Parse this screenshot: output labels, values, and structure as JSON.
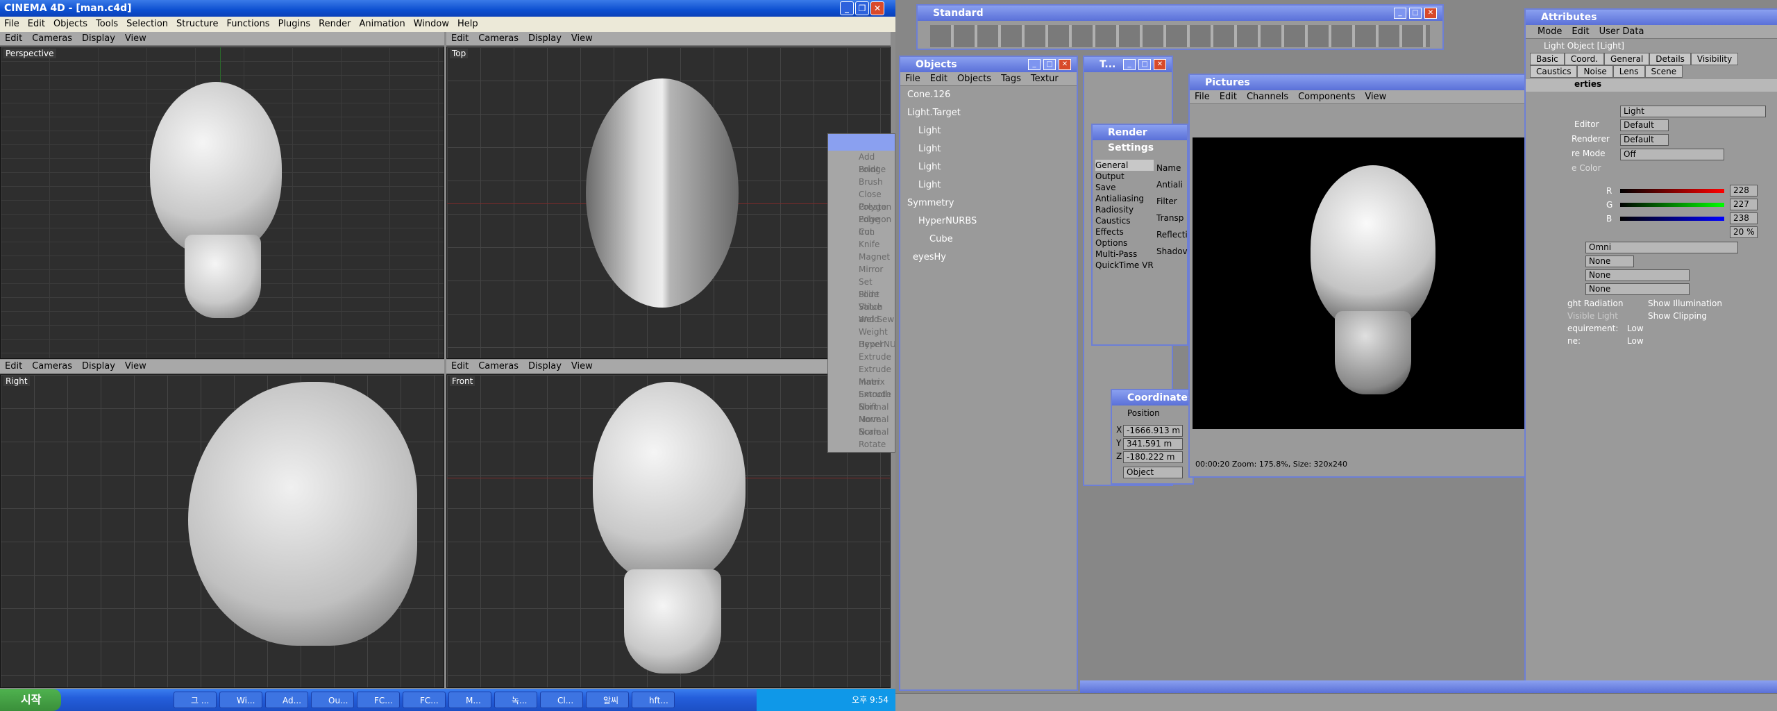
{
  "c4d": {
    "title": "CINEMA 4D - [man.c4d]",
    "menu": [
      "File",
      "Edit",
      "Objects",
      "Tools",
      "Selection",
      "Structure",
      "Functions",
      "Plugins",
      "Render",
      "Animation",
      "Window",
      "Help"
    ],
    "vpmenu": [
      "Edit",
      "Cameras",
      "Display",
      "View"
    ],
    "views": [
      "Perspective",
      "Top",
      "Right",
      "Front"
    ]
  },
  "tool_list": [
    "Add Point",
    "Bridge",
    "Brush",
    "Close Polygon",
    "Create Polygon",
    "Edge Cut",
    "Iron",
    "Knife",
    "Magnet",
    "Mirror",
    "Set Point Value",
    "Slide",
    "Stitch and Sew",
    "Weld",
    "Weight HyperNURBS",
    "Bevel",
    "Extrude",
    "Extrude Inner",
    "Matrix Extrude",
    "Smooth Shift",
    "Normal Move",
    "Normal Scale",
    "Normal Rotate"
  ],
  "standard": {
    "title": "Standard"
  },
  "objects": {
    "title": "Objects",
    "menu": [
      "File",
      "Edit",
      "Objects",
      "Tags",
      "Textur"
    ],
    "items": [
      "Cone.126",
      "Light.Target",
      "Light",
      "Light",
      "Light",
      "Light",
      "Symmetry",
      "HyperNURBS",
      "Cube",
      "eyesHy"
    ]
  },
  "t_panel": {
    "title": "T..."
  },
  "render": {
    "title": "Render Settings",
    "items": [
      "General",
      "Output",
      "Save",
      "Antialiasing",
      "Radiosity",
      "Caustics",
      "Effects",
      "Options",
      "Multi-Pass",
      "QuickTime VR"
    ],
    "right": [
      "Name",
      "Antiali",
      "Filter",
      "Transp",
      "Reflecti",
      "Shadov"
    ]
  },
  "coords": {
    "title": "Coordinates",
    "section": "Position",
    "x": "-1666.913 m",
    "y": "341.591 m",
    "z": "-180.222 m",
    "mode": "Object",
    "labels": [
      "X",
      "Y",
      "Z"
    ]
  },
  "pictures": {
    "title": "Pictures",
    "menu": [
      "File",
      "Edit",
      "Channels",
      "Components",
      "View"
    ],
    "status": "00:00:20  Zoom: 175.8%, Size: 320x240"
  },
  "attributes": {
    "title": "Attributes",
    "menu": [
      "Mode",
      "Edit",
      "User Data"
    ],
    "object": "Light Object [Light]",
    "tabs1": [
      "Basic",
      "Coord.",
      "General",
      "Details",
      "Visibility"
    ],
    "tabs2": [
      "Caustics",
      "Noise",
      "Lens",
      "Scene"
    ],
    "section": "erties",
    "name": "Light",
    "rows": [
      "Editor",
      "Renderer",
      "re Mode",
      "e Color"
    ],
    "vals": [
      "Default",
      "Default",
      "Off"
    ],
    "r": "228",
    "g": "227",
    "b": "238",
    "intensity": "20 %",
    "type": "Omni",
    "none1": "None",
    "none2": "None",
    "none3": "None",
    "extra": [
      "ght Radiation",
      "Visible Light",
      "equirement:",
      "ne:"
    ],
    "show_illum": "Show Illumination",
    "show_clip": "Show Clipping",
    "low1": "Low",
    "low2": "Low"
  },
  "taskbar": {
    "start": "시작",
    "items": [
      "그 ...",
      "Wi...",
      "Ad...",
      "Ou...",
      "FC...",
      "FC...",
      "M...",
      "녹...",
      "Cl...",
      "알씨",
      "hft..."
    ],
    "time": "오후 9:54"
  },
  "colors": {
    "xpblue": "#0d4fd0",
    "c4bg": "#9a9a9a",
    "panelblue": "#6d7fd6"
  }
}
